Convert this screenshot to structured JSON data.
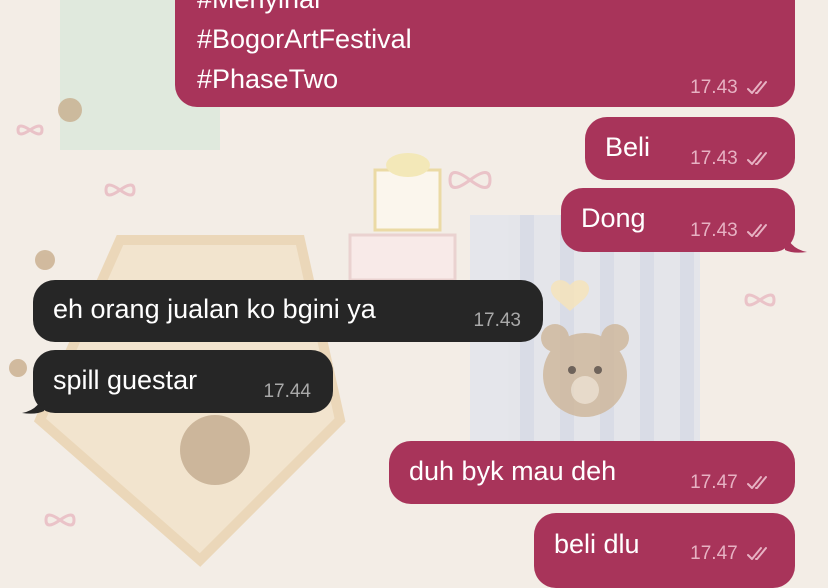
{
  "colors": {
    "outgoing_bubble": "#a8345a",
    "incoming_bubble": "#262626",
    "outgoing_time": "#e7b2c3",
    "incoming_time": "#a9a9a9",
    "wallpaper": "#f3ede6"
  },
  "messages": [
    {
      "direction": "outgoing",
      "lines": [
        "#Menyinar",
        "#BogorArtFestival",
        "#PhaseTwo"
      ],
      "time": "17.43",
      "status_icon": "double-check-icon"
    },
    {
      "direction": "outgoing",
      "text": "Beli",
      "time": "17.43",
      "status_icon": "double-check-icon"
    },
    {
      "direction": "outgoing",
      "text": "Dong",
      "time": "17.43",
      "status_icon": "double-check-icon"
    },
    {
      "direction": "incoming",
      "text": "eh orang jualan ko bgini ya",
      "time": "17.43"
    },
    {
      "direction": "incoming",
      "text": "spill guestar",
      "time": "17.44"
    },
    {
      "direction": "outgoing",
      "text": "duh byk mau deh",
      "time": "17.47",
      "status_icon": "double-check-icon"
    },
    {
      "direction": "outgoing",
      "text": "beli dlu",
      "time": "17.47",
      "status_icon": "double-check-icon"
    }
  ]
}
